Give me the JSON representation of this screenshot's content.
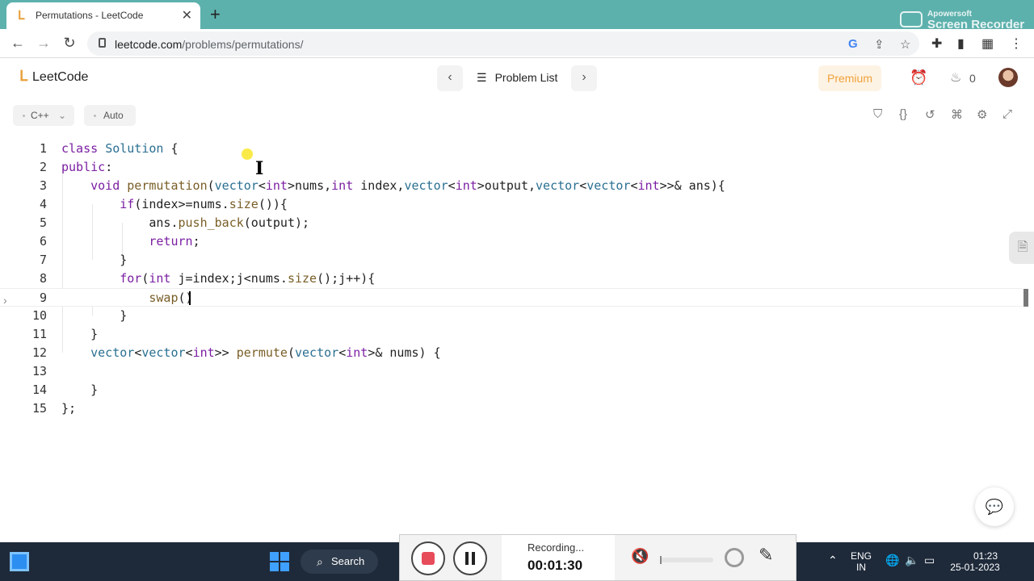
{
  "browser": {
    "tab_title": "Permutations - LeetCode",
    "url_host": "leetcode.com",
    "url_path": "/problems/permutations/",
    "watermark_small": "Apowersoft",
    "watermark_large": "Screen Recorder"
  },
  "header": {
    "logo_text": "LeetCode",
    "problem_list": "Problem List",
    "premium": "Premium",
    "streak_count": "0"
  },
  "editor": {
    "language": "C++",
    "mode": "Auto",
    "lines": [
      {
        "n": "1"
      },
      {
        "n": "2"
      },
      {
        "n": "3"
      },
      {
        "n": "4"
      },
      {
        "n": "5"
      },
      {
        "n": "6"
      },
      {
        "n": "7"
      },
      {
        "n": "8"
      },
      {
        "n": "9"
      },
      {
        "n": "10"
      },
      {
        "n": "11"
      },
      {
        "n": "12"
      },
      {
        "n": "13"
      },
      {
        "n": "14"
      },
      {
        "n": "15"
      }
    ],
    "code": [
      "class Solution {",
      "public:",
      "    void permutation(vector<int>nums,int index,vector<int>output,vector<vector<int>>& ans){",
      "        if(index>=nums.size()){",
      "            ans.push_back(output);",
      "            return;",
      "        }",
      "        for(int j=index;j<nums.size();j++){",
      "            swap()",
      "        }",
      "    }",
      "    vector<vector<int>> permute(vector<int>& nums) {",
      "",
      "    }",
      "};"
    ],
    "active_line": 9
  },
  "taskbar": {
    "search_label": "Search",
    "lang_top": "ENG",
    "lang_bottom": "IN",
    "time": "01:23",
    "date": "25-01-2023"
  },
  "recorder": {
    "status": "Recording...",
    "elapsed": "00:01:30"
  },
  "colors": {
    "tabstrip": "#5db1ad",
    "keyword": "#7a1fa2",
    "type": "#2a6f91",
    "function": "#795e26",
    "premium": "#f0a13a",
    "record_red": "#e74c5b"
  }
}
